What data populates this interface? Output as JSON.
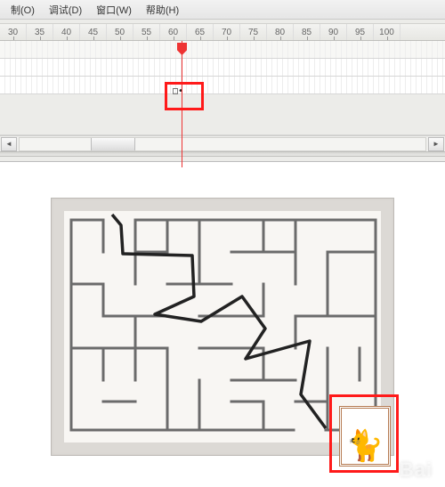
{
  "menubar": {
    "items": [
      {
        "label": "制(O)"
      },
      {
        "label": "调试(D)"
      },
      {
        "label": "窗口(W)"
      },
      {
        "label": "帮助(H)"
      }
    ]
  },
  "timeline": {
    "ruler_start": 30,
    "ruler_step": 5,
    "ruler_ticks": [
      "30",
      "35",
      "40",
      "45",
      "50",
      "55",
      "60",
      "65",
      "70",
      "75",
      "80",
      "85",
      "90",
      "95",
      "100"
    ],
    "playhead_frame": 60,
    "keyframe_symbol": "□•"
  },
  "watermark": "Bai",
  "highlights": {
    "timeline_marker": true,
    "cat_marker": true
  }
}
